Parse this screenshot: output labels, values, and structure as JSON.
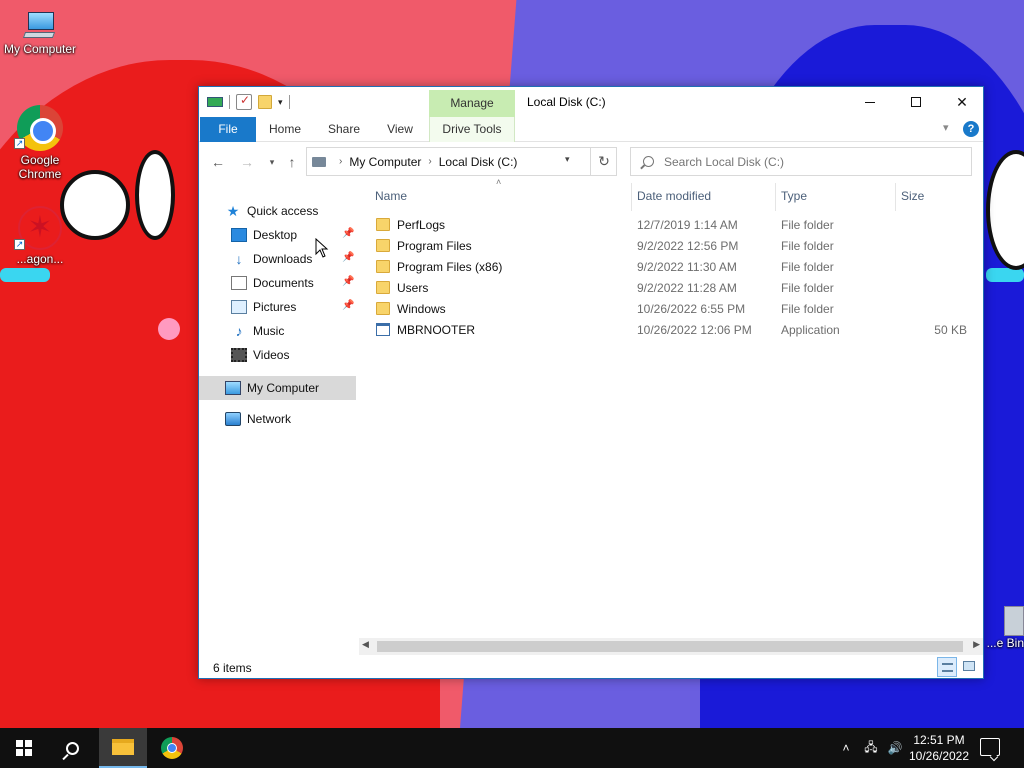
{
  "desktop": {
    "icons": [
      {
        "label": "My Computer"
      },
      {
        "label": "Google Chrome"
      },
      {
        "label": "...agon..."
      },
      {
        "label": "...e Bin"
      }
    ]
  },
  "window": {
    "title": "Local Disk (C:)",
    "context_tab_group": "Manage",
    "ribbon_tabs": [
      "File",
      "Home",
      "Share",
      "View",
      "Drive Tools"
    ]
  },
  "address": {
    "crumbs": [
      "My Computer",
      "Local Disk (C:)"
    ]
  },
  "search": {
    "placeholder": "Search Local Disk (C:)"
  },
  "navpane": {
    "items": [
      {
        "label": "Quick access",
        "icon": "star-icon"
      },
      {
        "label": "Desktop",
        "icon": "desktop-icon",
        "pinned": true
      },
      {
        "label": "Downloads",
        "icon": "download-icon",
        "pinned": true
      },
      {
        "label": "Documents",
        "icon": "documents-icon",
        "pinned": true
      },
      {
        "label": "Pictures",
        "icon": "pictures-icon",
        "pinned": true
      },
      {
        "label": "Music",
        "icon": "music-icon"
      },
      {
        "label": "Videos",
        "icon": "videos-icon"
      },
      {
        "label": "My Computer",
        "icon": "computer-icon",
        "selected": true
      },
      {
        "label": "Network",
        "icon": "network-icon"
      }
    ]
  },
  "filelist": {
    "columns": [
      "Name",
      "Date modified",
      "Type",
      "Size"
    ],
    "rows": [
      {
        "name": "PerfLogs",
        "date": "12/7/2019 1:14 AM",
        "type": "File folder",
        "size": "",
        "icon": "folder-icon"
      },
      {
        "name": "Program Files",
        "date": "9/2/2022 12:56 PM",
        "type": "File folder",
        "size": "",
        "icon": "folder-icon"
      },
      {
        "name": "Program Files (x86)",
        "date": "9/2/2022 11:30 AM",
        "type": "File folder",
        "size": "",
        "icon": "folder-icon"
      },
      {
        "name": "Users",
        "date": "9/2/2022 11:28 AM",
        "type": "File folder",
        "size": "",
        "icon": "folder-icon"
      },
      {
        "name": "Windows",
        "date": "10/26/2022 6:55 PM",
        "type": "File folder",
        "size": "",
        "icon": "folder-icon"
      },
      {
        "name": "MBRNOOTER",
        "date": "10/26/2022 12:06 PM",
        "type": "Application",
        "size": "50 KB",
        "icon": "application-icon"
      }
    ]
  },
  "status": {
    "item_count": "6 items"
  },
  "taskbar": {
    "time": "12:51 PM",
    "date": "10/26/2022"
  },
  "colors": {
    "accent": "#1979ca",
    "manage_tab": "#c8ecb2",
    "taskbar": "#101010"
  }
}
